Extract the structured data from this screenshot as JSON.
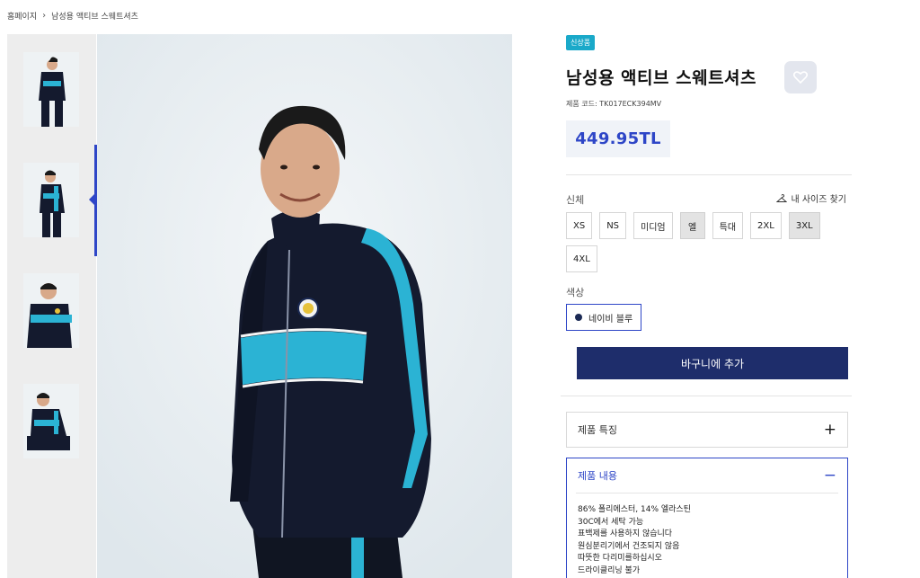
{
  "breadcrumb": {
    "home": "홈페이지",
    "separator": "›",
    "current": "남성용 액티브 스웨트셔츠"
  },
  "gallery": {
    "thumbnail_icons": [
      "player-front-photo",
      "player-side-photo",
      "player-portrait-photo",
      "player-seated-photo"
    ],
    "active_index": 1
  },
  "product": {
    "badge": "신상품",
    "title": "남성용 액티브 스웨트셔츠",
    "code": "제품 코드: TK017ECK394MV",
    "price": "449.95TL",
    "size_label": "신체",
    "size_guide": "내 사이즈 찾기",
    "sizes": [
      "XS",
      "NS",
      "미디엄",
      "엘",
      "특대",
      "2XL",
      "3XL",
      "4XL"
    ],
    "selected_sizes": [
      "엘",
      "3XL"
    ],
    "color_label": "색상",
    "color_name": "네이비 블루",
    "color_swatch": "#1b2a55",
    "add_to_cart": "바구니에 추가"
  },
  "accordion": {
    "features": {
      "title": "제품 특징",
      "icon": "+"
    },
    "content": {
      "title": "제품 내용",
      "icon": "−",
      "lines": [
        "86% 폴리에스터, 14% 엘라스틴",
        "30C에서 세탁 가능",
        "표백제를 사용하지 않습니다",
        "원심분리기에서 건조되지 않음",
        "따뜻한 다리미를하십시오",
        "드라이클리닝 불가"
      ]
    }
  },
  "colors": {
    "accent": "#2e46c7",
    "cart_button": "#1e2d6b",
    "badge": "#1aa9c9"
  }
}
